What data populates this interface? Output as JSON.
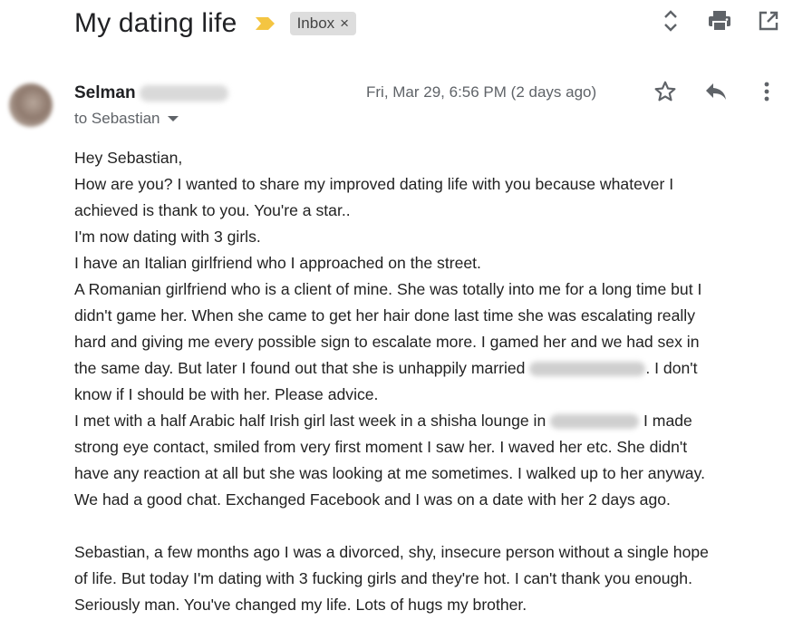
{
  "email": {
    "subject": "My dating life",
    "label": "Inbox",
    "label_remove": "×",
    "sender": {
      "name": "Selman"
    },
    "recipient": "to Sebastian",
    "date": "Fri, Mar 29, 6:56 PM (2 days ago)",
    "body_lines": [
      "Hey Sebastian,",
      "How are you? I wanted to share my improved dating life with you because whatever I",
      "achieved is thank to you. You're a star..",
      "I'm now dating with 3 girls.",
      "I have an Italian girlfriend who I approached on the street.",
      "A Romanian girlfriend who is a client of mine. She was totally into me for a long time but I",
      "didn't game her. When she came to get her hair done last time she was escalating really",
      "hard and giving me every possible sign to escalate more. I gamed her and we had sex in",
      {
        "pre": "the same day. But later I found out that she is unhappily married ",
        "post": ". I don't"
      },
      "know if I should be with her. Please advice.",
      {
        "pre": "I met with a half Arabic half Irish girl last week in a shisha lounge in ",
        "post": " I made"
      },
      "strong eye contact, smiled from very first moment I saw her. I waved her etc. She didn't",
      "have any reaction at all but she was looking at me sometimes. I walked up to her anyway.",
      "We had a good chat. Exchanged Facebook and I was on a date with her 2 days ago.",
      "",
      "Sebastian, a few months ago I was a divorced, shy, insecure person without a single hope",
      "of life. But today I'm dating with 3 fucking girls and they're hot. I can't thank you enough.",
      "Seriously man. You've changed my life. Lots of hugs my brother."
    ]
  },
  "icons": {
    "importance": "importance-marker-icon",
    "expand": "expand-collapse-icon",
    "print": "print-icon",
    "new_window": "open-in-new-window-icon",
    "star": "star-icon",
    "reply": "reply-icon",
    "more": "more-vert-icon"
  },
  "colors": {
    "importance": "#f4c542",
    "text": "#202124",
    "secondary": "#5f6368",
    "chip": "#dddddd"
  }
}
